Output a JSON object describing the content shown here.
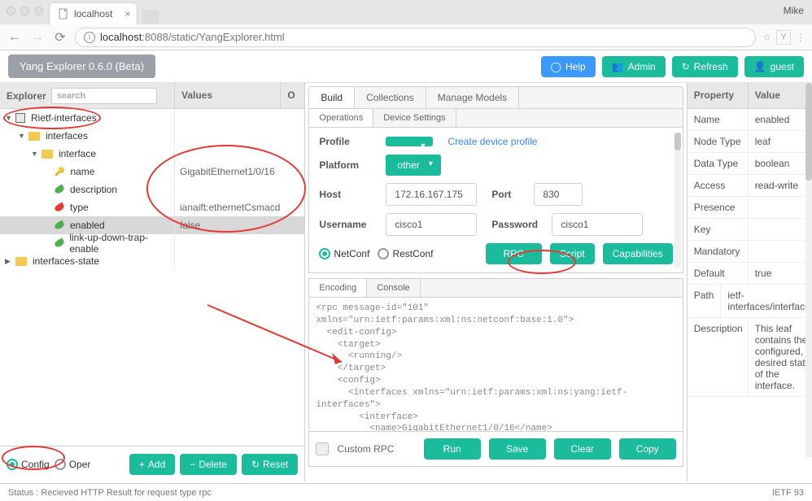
{
  "browser": {
    "tab_title": "localhost",
    "user": "Mike",
    "url_host": "localhost",
    "url_rest": ":8088/static/YangExplorer.html"
  },
  "toolbar": {
    "app_title": "Yang Explorer 0.6.0 (Beta)",
    "help": "Help",
    "admin": "Admin",
    "refresh": "Refresh",
    "guest": "guest"
  },
  "left": {
    "hdr_explorer": "Explorer",
    "hdr_values": "Values",
    "hdr_o": "O",
    "search_placeholder": "search",
    "tree": [
      {
        "indent": 0,
        "arrow": "▼",
        "icon": "module",
        "label": "Rietf-interfaces",
        "value": ""
      },
      {
        "indent": 1,
        "arrow": "▼",
        "icon": "folder",
        "label": "interfaces",
        "value": ""
      },
      {
        "indent": 2,
        "arrow": "▼",
        "icon": "folder",
        "label": "interface",
        "value": ""
      },
      {
        "indent": 3,
        "arrow": "",
        "icon": "key",
        "label": "name",
        "value": "GigabitEthernet1/0/16"
      },
      {
        "indent": 3,
        "arrow": "",
        "icon": "leaf",
        "label": "description",
        "value": ""
      },
      {
        "indent": 3,
        "arrow": "",
        "icon": "leaf-red",
        "label": "type",
        "value": "ianaift:ethernetCsmacd"
      },
      {
        "indent": 3,
        "arrow": "",
        "icon": "leaf",
        "label": "enabled",
        "value": "false",
        "selected": true
      },
      {
        "indent": 3,
        "arrow": "",
        "icon": "leaf",
        "label": "link-up-down-trap-enable",
        "value": ""
      },
      {
        "indent": 0,
        "arrow": "▶",
        "icon": "folder",
        "label": "interfaces-state",
        "value": ""
      }
    ],
    "footer": {
      "config": "Config",
      "oper": "Oper",
      "add": "Add",
      "delete": "Delete",
      "reset": "Reset"
    }
  },
  "mid": {
    "tabs": {
      "build": "Build",
      "collections": "Collections",
      "manage": "Manage Models"
    },
    "subtabs": {
      "operations": "Operations",
      "device": "Device Settings"
    },
    "form": {
      "profile_label": "Profile",
      "profile_value": "",
      "create_link": "Create device profile",
      "platform_label": "Platform",
      "platform_value": "other",
      "host_label": "Host",
      "host_value": "172.16.167.175",
      "port_label": "Port",
      "port_value": "830",
      "user_label": "Username",
      "user_value": "cisco1",
      "pass_label": "Password",
      "pass_value": "cisco1",
      "netconf": "NetConf",
      "restconf": "RestConf",
      "rpc": "RPC",
      "script": "Script",
      "caps": "Capabilities"
    },
    "codetabs": {
      "encoding": "Encoding",
      "console": "Console"
    },
    "code": "<rpc message-id=\"101\"\nxmlns=\"urn:ietf:params:xml:ns:netconf:base:1.0\">\n  <edit-config>\n    <target>\n      <running/>\n    </target>\n    <config>\n      <interfaces xmlns=\"urn:ietf:params:xml:ns:yang:ietf-\ninterfaces\">\n        <interface>\n          <name>GigabitEthernet1/0/16</name>\n          <type xmlns:ianaift=\"urn:ietf:params:xml:ns:yang:iana-if-\ntype\">ianaift:ethernetCsmacd</type>\n          <enabled>false</enabled>\n        </interface>",
    "runbar": {
      "custom": "Custom RPC",
      "run": "Run",
      "save": "Save",
      "clear": "Clear",
      "copy": "Copy"
    }
  },
  "right": {
    "hdr_prop": "Property",
    "hdr_val": "Value",
    "rows": [
      {
        "k": "Name",
        "v": "enabled"
      },
      {
        "k": "Node Type",
        "v": "leaf"
      },
      {
        "k": "Data Type",
        "v": "boolean"
      },
      {
        "k": "Access",
        "v": "read-write"
      },
      {
        "k": "Presence",
        "v": ""
      },
      {
        "k": "Key",
        "v": ""
      },
      {
        "k": "Mandatory",
        "v": ""
      },
      {
        "k": "Default",
        "v": "true"
      },
      {
        "k": "Path",
        "v": "ietf-interfaces/interfaces/interface/enabled"
      },
      {
        "k": "Description",
        "v": "This leaf contains the configured, desired state of the interface."
      }
    ]
  },
  "status": {
    "left": "Status : Recieved HTTP Result for request type rpc",
    "right": "IETF 93"
  }
}
